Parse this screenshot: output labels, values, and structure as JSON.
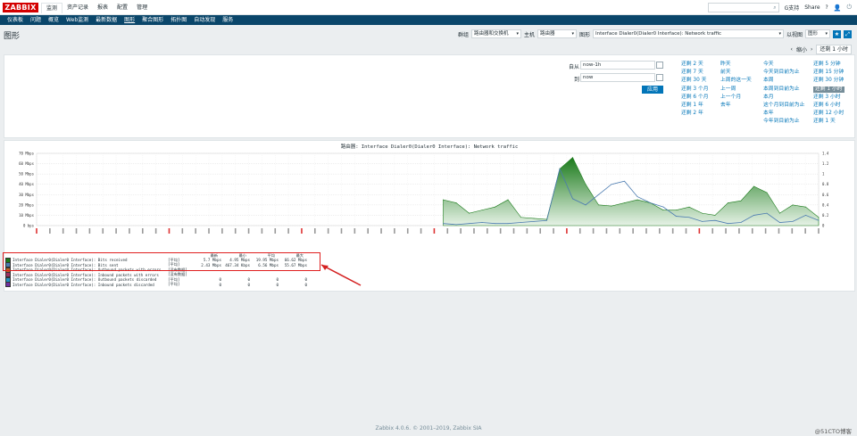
{
  "topbar": {
    "logo": "ZABBIX",
    "menu": [
      "监测",
      "资产记录",
      "报表",
      "配置",
      "管理"
    ],
    "support": "G支持",
    "share": "Share",
    "help": "?"
  },
  "submenu": [
    "仪表板",
    "问题",
    "概览",
    "Web监测",
    "最新数据",
    "图形",
    "聚合图形",
    "拓扑图",
    "自动发现",
    "服务"
  ],
  "header": {
    "title": "图形",
    "group_label": "群组",
    "group_value": "路由器和交换机",
    "host_label": "主机",
    "host_value": "路由器",
    "graph_label": "图形",
    "graph_value": "Interface Dialer0(Dialer0 Interface): Network traffic",
    "view_label": "以视图",
    "view_value": "图形"
  },
  "timenav": {
    "zoom_out": "缩小",
    "current": "还剩 1 小时"
  },
  "timepanel": {
    "from_label": "自从",
    "from_value": "now-1h",
    "to_label": "到",
    "to_value": "now",
    "apply": "应用",
    "quick": [
      [
        "还剩 2 天",
        "还剩 7 天",
        "还剩 30 天",
        "还剩 3 个月",
        "还剩 6 个月",
        "还剩 1 年",
        "还剩 2 年"
      ],
      [
        "昨天",
        "前天",
        "上周的这一天",
        "上一周",
        "上一个月",
        "去年"
      ],
      [
        "今天",
        "今天到目前为止",
        "本周",
        "本周到目前为止",
        "本月",
        "这个月到目前为止",
        "本年",
        "今年到目前为止"
      ],
      [
        "还剩 5 分钟",
        "还剩 15 分钟",
        "还剩 30 分钟",
        "还剩 1 小时",
        "还剩 3 小时",
        "还剩 6 小时",
        "还剩 12 小时",
        "还剩 1 天"
      ]
    ]
  },
  "chart_data": {
    "type": "area",
    "title": "路由器: Interface Dialer0(Dialer0 Interface): Network traffic",
    "ylabel_left_ticks": [
      "70 Mbps",
      "60 Mbps",
      "50 Mbps",
      "40 Mbps",
      "30 Mbps",
      "20 Mbps",
      "10 Mbps",
      "0 bps"
    ],
    "ylabel_right_ticks": [
      "1.4",
      "1.2",
      "1",
      "0.8",
      "0.6",
      "0.4",
      "0.2",
      "0"
    ],
    "ylim": [
      0,
      70
    ],
    "series": [
      {
        "name": "Interface Dialer0(Dialer0 Interface): Bits received",
        "color": "#1a7a1a",
        "values": [
          25,
          22,
          12,
          15,
          18,
          25,
          8,
          7,
          6,
          55,
          66,
          40,
          20,
          19,
          22,
          25,
          22,
          15,
          15,
          18,
          12,
          10,
          22,
          24,
          38,
          32,
          12,
          20,
          18,
          8
        ]
      },
      {
        "name": "Interface Dialer0(Dialer0 Interface): Bits sent",
        "color": "#4a7ab0",
        "values": [
          2,
          1,
          2,
          3,
          2,
          2,
          3,
          4,
          5,
          55,
          26,
          20,
          30,
          40,
          43,
          28,
          22,
          18,
          9,
          8,
          4,
          5,
          2,
          3,
          10,
          12,
          3,
          4,
          10,
          5
        ]
      }
    ]
  },
  "legend": {
    "headers": [
      "最新",
      "最小",
      "平均",
      "最大"
    ],
    "rows": [
      {
        "name": "Interface Dialer0(Dialer0 Interface): Bits received",
        "fn": "[平均]",
        "last": "5.7 Mbps",
        "min": "4.95 Mbps",
        "avg": "19.95 Mbps",
        "max": "66.62 Mbps",
        "color": "#1a7a1a"
      },
      {
        "name": "Interface Dialer0(Dialer0 Interface): Bits sent",
        "fn": "[平均]",
        "last": "2.43 Mbps",
        "min": "467.34 Kbps",
        "avg": "6.56 Mbps",
        "max": "55.67 Mbps",
        "color": "#4a7ab0"
      },
      {
        "name": "Interface Dialer0(Dialer0 Interface): Outbound packets with errors",
        "fn": "[没有数据]",
        "last": "",
        "min": "",
        "avg": "",
        "max": "",
        "color": "#c06020"
      },
      {
        "name": "Interface Dialer0(Dialer0 Interface): Inbound packets with errors",
        "fn": "[没有数据]",
        "last": "",
        "min": "",
        "avg": "",
        "max": "",
        "color": "#a03060"
      },
      {
        "name": "Interface Dialer0(Dialer0 Interface): Outbound packets discarded",
        "fn": "[平均]",
        "last": "0",
        "min": "0",
        "avg": "0",
        "max": "0",
        "color": "#2090c0"
      },
      {
        "name": "Interface Dialer0(Dialer0 Interface): Inbound packets discarded",
        "fn": "[平均]",
        "last": "0",
        "min": "0",
        "avg": "0",
        "max": "0",
        "color": "#7030a0"
      }
    ]
  },
  "footer": "Zabbix 4.0.6. © 2001–2019, Zabbix SIA",
  "watermark": "@51CTO博客"
}
